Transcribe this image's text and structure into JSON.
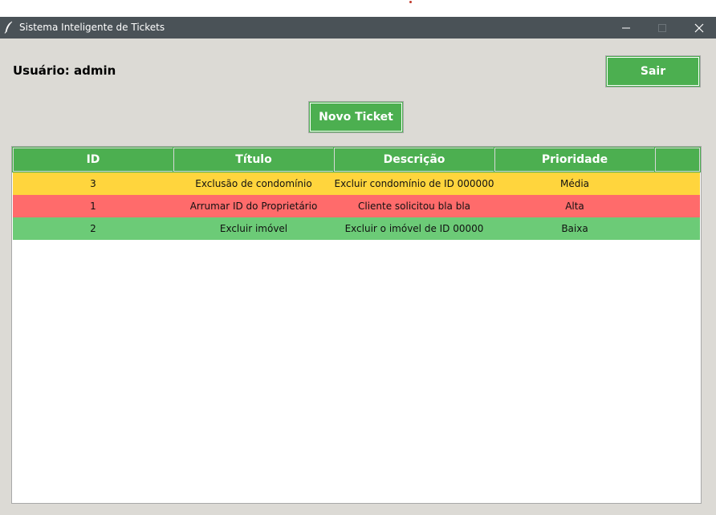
{
  "window": {
    "title": "Sistema Inteligente de Tickets"
  },
  "header": {
    "user_label": "Usuário: admin",
    "logout_label": "Sair",
    "new_ticket_label": "Novo Ticket"
  },
  "table": {
    "columns": [
      "ID",
      "Título",
      "Descrição",
      "Prioridade",
      ""
    ],
    "rows": [
      {
        "id": "3",
        "titulo": "Exclusão de condomínio",
        "descricao": "Excluir condomínio de ID 000000",
        "prioridade": "Média",
        "color": "#ffd53d"
      },
      {
        "id": "1",
        "titulo": "Arrumar ID do Proprietário",
        "descricao": "Cliente solicitou bla bla",
        "prioridade": "Alta",
        "color": "#ff6b6b"
      },
      {
        "id": "2",
        "titulo": "Excluir imóvel",
        "descricao": "Excluir o imóvel de ID 00000",
        "prioridade": "Baixa",
        "color": "#6ccb77"
      }
    ]
  },
  "colors": {
    "accent_green": "#4caf50",
    "titlebar": "#4a5257",
    "background": "#dcdad5"
  },
  "icons": {
    "app": "feather-icon",
    "minimize": "minimize-icon",
    "maximize": "maximize-icon",
    "close": "close-icon"
  }
}
